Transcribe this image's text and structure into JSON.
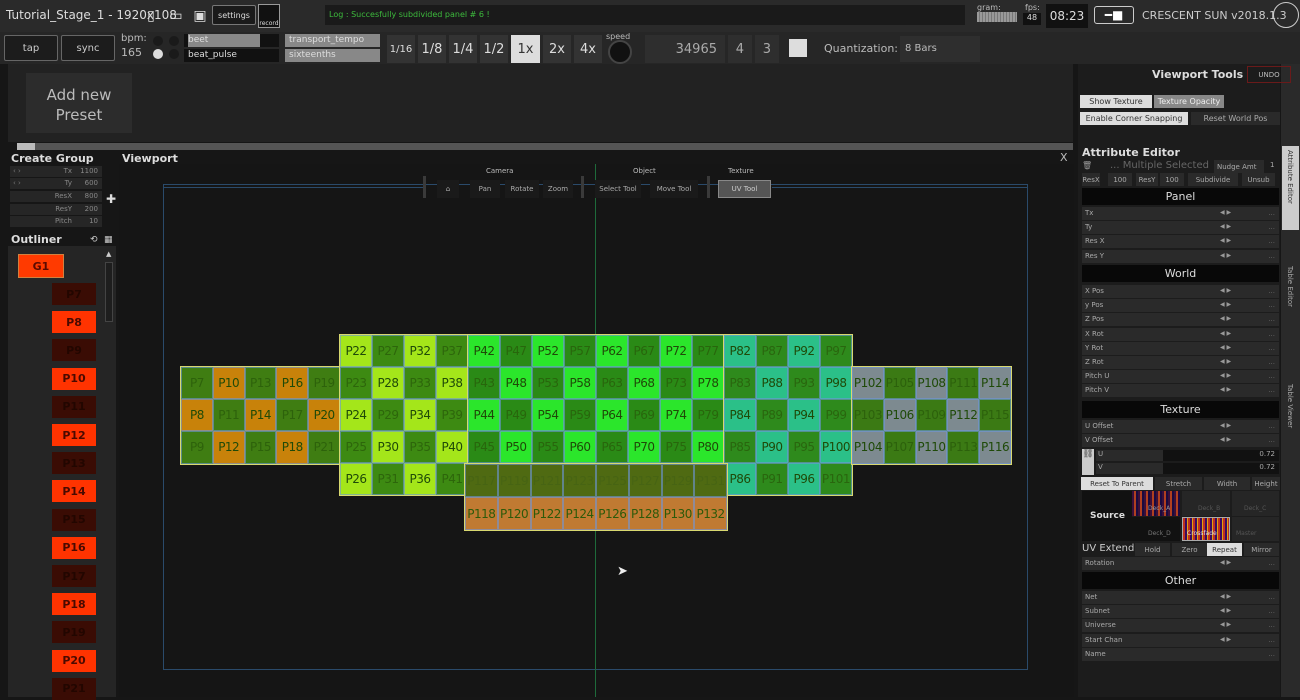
{
  "window": {
    "title": "Tutorial_Stage_1 - 1920x108",
    "settings_label": "settings",
    "record_label": "record",
    "log_text": "Log : Succesfully subdivided panel # 6 !",
    "gram_label": "gram:",
    "fps_label": "fps:",
    "fps_value": "48",
    "clock": "08:23",
    "app_name": "CRESCENT SUN v2018.1.3"
  },
  "transport": {
    "tap_label": "tap",
    "sync_label": "sync",
    "bpm_label": "bpm:",
    "bpm_value": "165",
    "beat_label": "beet",
    "beat_pulse_label": "beat_pulse",
    "transport_tempo_label": "transport_tempo",
    "sixteenths_label": "sixteenths",
    "rate_buttons": [
      "1/16",
      "1/8",
      "1/4",
      "1/2",
      "1x",
      "2x",
      "4x"
    ],
    "active_rate": "1x",
    "speed_label": "speed",
    "counter": "34965",
    "bar": "4",
    "beat": "3",
    "quantization_label": "Quantization:",
    "quantization_value": "8 Bars"
  },
  "presets": {
    "add_label": "Add new Preset"
  },
  "create_group": {
    "title": "Create Group",
    "fields": [
      {
        "key": "Tx",
        "value": "1100"
      },
      {
        "key": "Ty",
        "value": "600"
      },
      {
        "key": "ResX",
        "value": "800"
      },
      {
        "key": "ResY",
        "value": "200"
      },
      {
        "key": "Pitch",
        "value": "10"
      }
    ]
  },
  "outliner": {
    "title": "Outliner",
    "group": "G1",
    "items": [
      {
        "label": "P7",
        "on": false
      },
      {
        "label": "P8",
        "on": true
      },
      {
        "label": "P9",
        "on": false
      },
      {
        "label": "P10",
        "on": true
      },
      {
        "label": "P11",
        "on": false
      },
      {
        "label": "P12",
        "on": true
      },
      {
        "label": "P13",
        "on": false
      },
      {
        "label": "P14",
        "on": true
      },
      {
        "label": "P15",
        "on": false
      },
      {
        "label": "P16",
        "on": true
      },
      {
        "label": "P17",
        "on": false
      },
      {
        "label": "P18",
        "on": true
      },
      {
        "label": "P19",
        "on": false
      },
      {
        "label": "P20",
        "on": true
      },
      {
        "label": "P21",
        "on": false
      }
    ]
  },
  "viewport": {
    "title": "Viewport",
    "close_label": "X",
    "toolbar": {
      "groups": [
        "Camera",
        "Object",
        "Texture"
      ],
      "camera_buttons": [
        "Pan",
        "Rotate",
        "Zoom"
      ],
      "object_buttons": [
        "Select Tool",
        "Move Tool"
      ],
      "texture_buttons": [
        "UV Tool"
      ],
      "active_tool": "UV Tool"
    },
    "panel_groups": [
      {
        "name": "left-orange",
        "light": "#c8820a",
        "dark": "#3f7d12",
        "cols": 5,
        "rows": 3,
        "start": 7,
        "col_step": 3,
        "light_first_odd_col": true
      },
      {
        "name": "yellow-green",
        "light": "#a4e61a",
        "dark": "#3d8a12",
        "cols": 4,
        "rows": 5,
        "start": 22
      },
      {
        "name": "bright-green",
        "light": "#2be62b",
        "dark": "#2a8a16",
        "cols": 8,
        "rows": 4,
        "start": 42
      },
      {
        "name": "teal",
        "light": "#2bc088",
        "dark": "#2e8a1c",
        "cols": 4,
        "rows": 5,
        "start": 82
      },
      {
        "name": "grey",
        "light": "#7d8a90",
        "dark": "#3b7a14",
        "cols": 5,
        "rows": 3,
        "start": 102
      },
      {
        "name": "bottom-orange",
        "light": "#c07a32",
        "dark": "#4a6a10",
        "cols": 8,
        "rows": 2,
        "start": 117
      }
    ],
    "panel_labels": {
      "left": [
        [
          "P7",
          "P10",
          "P13",
          "P16",
          "P19"
        ],
        [
          "P8",
          "P11",
          "P14",
          "P17",
          "P20"
        ],
        [
          "P9",
          "P12",
          "P15",
          "P18",
          "P21"
        ]
      ],
      "yellow": [
        [
          "P22",
          "P27",
          "P32",
          "P37"
        ],
        [
          "P23",
          "P28",
          "P33",
          "P38"
        ],
        [
          "P24",
          "P29",
          "P34",
          "P39"
        ],
        [
          "P25",
          "P30",
          "P35",
          "P40"
        ],
        [
          "P26",
          "P31",
          "P36",
          "P41"
        ]
      ],
      "green": [
        [
          "P42",
          "P47",
          "P52",
          "P57",
          "P62",
          "P67",
          "P72",
          "P77"
        ],
        [
          "P43",
          "P48",
          "P53",
          "P58",
          "P63",
          "P68",
          "P73",
          "P78"
        ],
        [
          "P44",
          "P49",
          "P54",
          "P59",
          "P64",
          "P69",
          "P74",
          "P79"
        ],
        [
          "P45",
          "P50",
          "P55",
          "P60",
          "P65",
          "P70",
          "P75",
          "P80"
        ]
      ],
      "teal": [
        [
          "P82",
          "P87",
          "P92",
          "P97"
        ],
        [
          "P83",
          "P88",
          "P93",
          "P98"
        ],
        [
          "P84",
          "P89",
          "P94",
          "P99"
        ],
        [
          "P85",
          "P90",
          "P95",
          "P100"
        ],
        [
          "P86",
          "P91",
          "P96",
          "P101"
        ]
      ],
      "grey": [
        [
          "P102",
          "P105",
          "P108",
          "P111",
          "P114"
        ],
        [
          "P103",
          "P106",
          "P109",
          "P112",
          "P115"
        ],
        [
          "P104",
          "P107",
          "P110",
          "P113",
          "P116"
        ]
      ],
      "bottom": [
        [
          "P117",
          "P119",
          "P121",
          "P123",
          "P125",
          "P127",
          "P129",
          "P131"
        ],
        [
          "P118",
          "P120",
          "P122",
          "P124",
          "P126",
          "P128",
          "P130",
          "P132"
        ]
      ]
    }
  },
  "viewport_tools": {
    "title": "Viewport Tools",
    "undo_label": "UNDO",
    "show_texture": "Show Texture",
    "texture_opacity": "Texture Opacity",
    "corner_snapping": "Enable Corner Snapping",
    "reset_world_pos": "Reset World Pos"
  },
  "attribute_editor": {
    "title": "Attribute Editor",
    "selection": "... Multiple Selected",
    "nudge_label": "Nudge Amt",
    "nudge_value": "1",
    "resx_label": "ResX",
    "resx_value": "100",
    "resy_label": "ResY",
    "resy_value": "100",
    "subdivide_label": "Subdivide",
    "unsub_label": "Unsub",
    "sections": {
      "panel": {
        "title": "Panel",
        "rows": [
          "Tx",
          "Ty",
          "Res X",
          "Res Y"
        ]
      },
      "world": {
        "title": "World",
        "rows": [
          "X Pos",
          "y Pos",
          "Z Pos",
          "X Rot",
          "Y Rot",
          "Z Rot",
          "Pitch U",
          "Pitch V"
        ]
      },
      "texture": {
        "title": "Texture",
        "rows": [
          "U Offset",
          "V Offset"
        ]
      },
      "other": {
        "title": "Other",
        "rows": [
          "Net",
          "Subnet",
          "Universe",
          "Start Chan",
          "Name"
        ]
      }
    },
    "u_value": "0.72",
    "v_value": "0.72",
    "u_label": "U",
    "v_label": "V",
    "fit_buttons": [
      "Reset To Parent",
      "Stretch",
      "Width",
      "Height"
    ],
    "source_label": "Source",
    "source_decks": [
      "Deck_A",
      "Deck_B",
      "Deck_C",
      "Deck_D",
      "Crossfade",
      "Master"
    ],
    "uv_extend_label": "UV Extend",
    "uv_extend_options": [
      "Hold",
      "Zero",
      "Repeat",
      "Mirror"
    ],
    "uv_extend_active": "Repeat",
    "rotation_label": "Rotation",
    "side_tabs": [
      "Attribute Editor",
      "Table Editor",
      "Table Viewer"
    ]
  }
}
